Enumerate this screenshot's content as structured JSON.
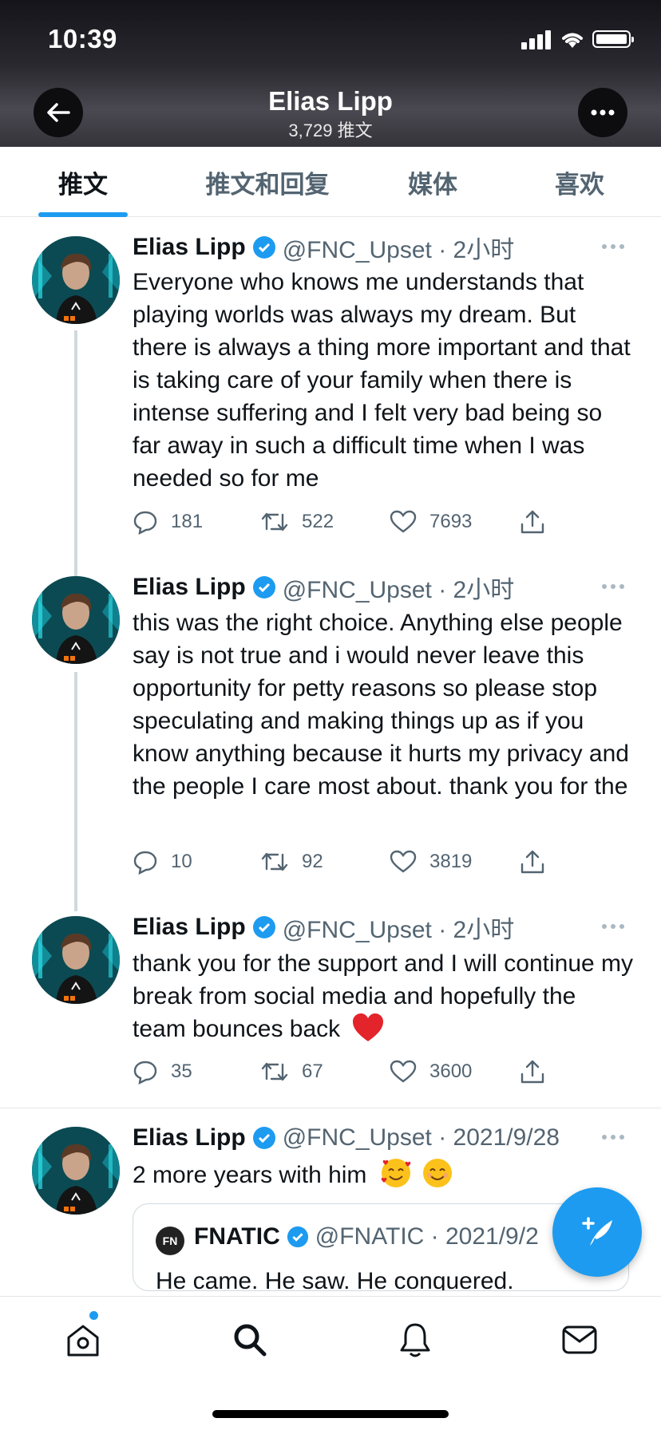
{
  "status_bar": {
    "time": "10:39"
  },
  "header": {
    "title": "Elias Lipp",
    "subtitle": "3,729 推文"
  },
  "tabs": [
    {
      "label": "推文",
      "active": true
    },
    {
      "label": "推文和回复",
      "active": false
    },
    {
      "label": "媒体",
      "active": false
    },
    {
      "label": "喜欢",
      "active": false
    }
  ],
  "tweets": [
    {
      "name": "Elias Lipp",
      "meta": "@FNC_Upset · 2小时",
      "text": "Everyone who knows me understands that playing worlds was always my dream. But there is always a thing more important and that is taking care of your family when there is intense suffering and I felt very bad being so far away in such a difficult time when I was needed so for me",
      "replies": "181",
      "retweets": "522",
      "likes": "7693"
    },
    {
      "name": "Elias Lipp",
      "meta": "@FNC_Upset · 2小时",
      "text": "this was the right choice. Anything else people say is not true and i would never leave this opportunity for petty reasons so please stop speculating and making things up as if you know anything because it hurts my privacy and the people I care most about. thank you for the",
      "replies": "10",
      "retweets": "92",
      "likes": "3819"
    },
    {
      "name": "Elias Lipp",
      "meta": "@FNC_Upset · 2小时",
      "text": "thank you for the support and I will continue my break from social media and hopefully the team bounces back",
      "replies": "35",
      "retweets": "67",
      "likes": "3600"
    },
    {
      "name": "Elias Lipp",
      "meta": "@FNC_Upset · 2021/9/28",
      "text": "2 more years with him",
      "quote": {
        "name": "FNATIC",
        "meta": "@FNATIC · 2021/9/2",
        "text": "He came. He saw. He conquered."
      }
    }
  ],
  "colors": {
    "accent": "#1d9bf0",
    "text": "#0f1419",
    "muted": "#536471"
  }
}
